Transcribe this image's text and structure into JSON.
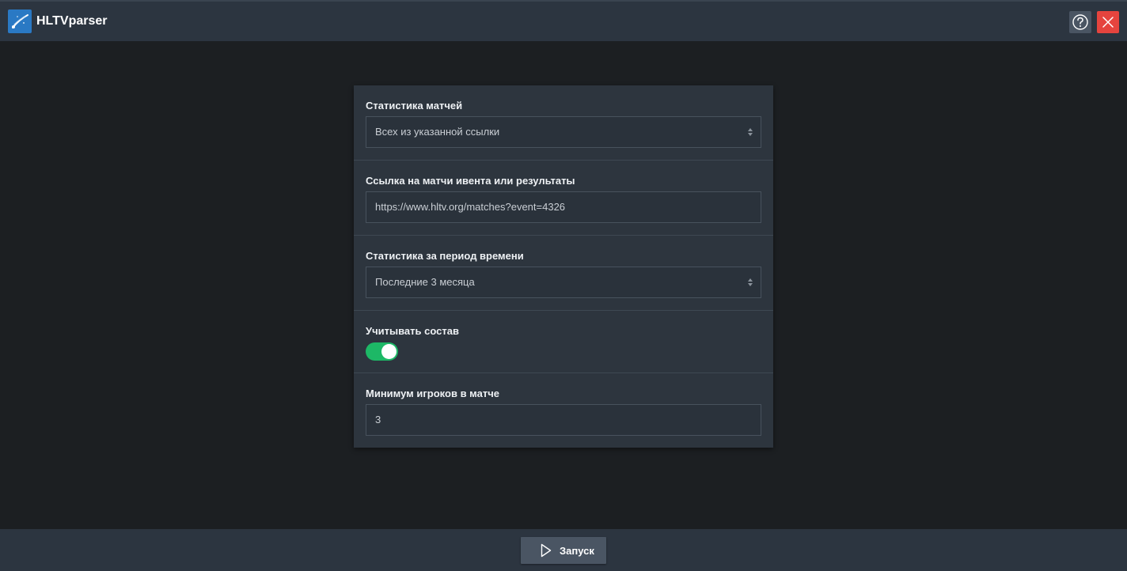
{
  "app": {
    "title": "HLTVparser",
    "logo_icon": "comet-icon",
    "help_icon": "question-circle-icon",
    "close_icon": "close-icon"
  },
  "form": {
    "match_stats": {
      "label": "Статистика матчей",
      "selected": "Всех из указанной ссылки"
    },
    "link": {
      "label": "Ссылка на матчи ивента или результаты",
      "value": "https://www.hltv.org/matches?event=4326"
    },
    "period": {
      "label": "Статистика за период времени",
      "selected": "Последние 3 месяца"
    },
    "lineup": {
      "label": "Учитывать состав",
      "enabled": true
    },
    "min_players": {
      "label": "Минимум игроков в матче",
      "value": "3"
    }
  },
  "footer": {
    "run_label": "Запуск",
    "run_icon": "play-icon"
  },
  "colors": {
    "accent": "#1db866",
    "close": "#e5443e",
    "logo": "#2a79c4",
    "background": "#1c1f22",
    "panel": "#2d353e"
  }
}
